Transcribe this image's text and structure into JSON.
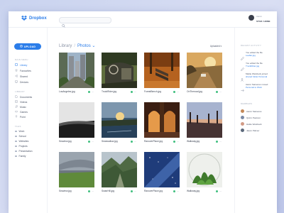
{
  "app": {
    "name": "Dropbox"
  },
  "search": {
    "placeholder": ""
  },
  "user": {
    "name": "Aaron",
    "plan_label": "STAR / HOME"
  },
  "sidebar": {
    "upload_label": "UPLOAD",
    "sections": [
      {
        "title": "MAIN MENU",
        "items": [
          {
            "label": "Library",
            "icon": "library-icon",
            "active": true
          },
          {
            "label": "Favourites",
            "icon": "star-icon",
            "active": false
          },
          {
            "label": "Shared",
            "icon": "share-icon",
            "active": false
          },
          {
            "label": "Devices",
            "icon": "device-icon",
            "active": false
          }
        ]
      },
      {
        "title": "LIBRARY",
        "items": [
          {
            "label": "Documents",
            "icon": "document-icon",
            "active": false
          },
          {
            "label": "Videos",
            "icon": "video-icon",
            "active": false
          },
          {
            "label": "Music",
            "icon": "music-icon",
            "active": false
          },
          {
            "label": "Games",
            "icon": "game-icon",
            "active": false
          },
          {
            "label": "Point",
            "icon": "point-icon",
            "active": false
          }
        ]
      },
      {
        "title": "TAGS",
        "items": [
          {
            "label": "Work",
            "icon": "tag-icon"
          },
          {
            "label": "School",
            "icon": "tag-icon"
          },
          {
            "label": "Websites",
            "icon": "tag-icon"
          },
          {
            "label": "Projects",
            "icon": "tag-icon"
          },
          {
            "label": "Presentation",
            "icon": "tag-icon"
          },
          {
            "label": "Family",
            "icon": "tag-icon"
          }
        ]
      }
    ]
  },
  "main": {
    "breadcrumb": [
      "Library",
      "Photos"
    ],
    "sort_label": "Uploaded",
    "files": [
      {
        "name": "LosAngeles.jpg"
      },
      {
        "name": "TruckRider.jpg"
      },
      {
        "name": "ForestBench.jpg"
      },
      {
        "name": "OnTheroad.jpg"
      },
      {
        "name": "Seaview.jpg"
      },
      {
        "name": "Seaswallow.jpg"
      },
      {
        "name": "RanoverPlace.jpg"
      },
      {
        "name": "Walkway.jpg"
      },
      {
        "name": "Seaview.jpg"
      },
      {
        "name": "SwanHill.jpg"
      },
      {
        "name": "RanoverPlace.jpg"
      },
      {
        "name": "Walkway.jpg"
      }
    ]
  },
  "right": {
    "activity_title": "RECENT ACTIVITY",
    "activity": [
      {
        "line1": "You edited the file",
        "line2": "Leaflet.jpg"
      },
      {
        "line1": "You edited the file",
        "line2": "TruckRider.jpg"
      },
      {
        "line1": "Mattie Weisbeck joined",
        "line2": "shared folder Personal"
      },
      {
        "line1": "Aaron Sanseres moved",
        "line2": "Personal to Work"
      }
    ],
    "members_title": "MEMBERS",
    "members": [
      {
        "name": "Aaron Sanseres",
        "color": "#c48a5a"
      },
      {
        "name": "Quinn Pearson",
        "color": "#7a8aa6"
      },
      {
        "name": "Hattie Weisbeck",
        "color": "#d29b86"
      },
      {
        "name": "Jason Palmer",
        "color": "#5d6a7c"
      }
    ]
  },
  "colors": {
    "accent": "#2b7de9",
    "synced": "#3fbf7f"
  }
}
